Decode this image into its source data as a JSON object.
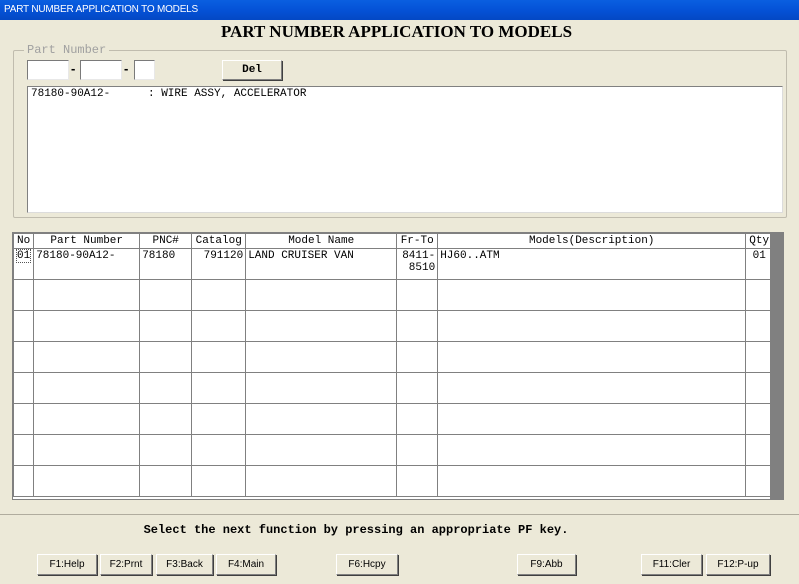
{
  "window": {
    "title": "PART NUMBER APPLICATION TO MODELS"
  },
  "heading": "PART NUMBER APPLICATION TO MODELS",
  "part_number": {
    "legend": "Part Number",
    "field1": "",
    "field2": "",
    "field3": "",
    "separator": "-",
    "del_label": "Del",
    "result": {
      "part": "78180-90A12-",
      "description": ": WIRE ASSY, ACCELERATOR"
    }
  },
  "grid": {
    "headers": {
      "no": "No",
      "part": "Part Number",
      "pnc": "PNC#",
      "catalog": "Catalog",
      "model": "Model Name",
      "frto": "Fr-To",
      "desc": "Models(Description)",
      "qty": "Qty"
    },
    "rows": [
      {
        "no": "01",
        "part": "78180-90A12-",
        "pnc": "78180",
        "catalog": "791120",
        "model": "LAND CRUISER VAN",
        "fr": "8411-",
        "to": "8510",
        "desc": "HJ60..ATM",
        "qty": "01"
      }
    ]
  },
  "status": "Select the next function by pressing an appropriate PF key.",
  "fkeys": {
    "f1": "F1:Help",
    "f2": "F2:Prnt",
    "f3": "F3:Back",
    "f4": "F4:Main",
    "f6": "F6:Hcpy",
    "f9": "F9:Abb",
    "f11": "F11:Cler",
    "f12": "F12:P-up"
  }
}
